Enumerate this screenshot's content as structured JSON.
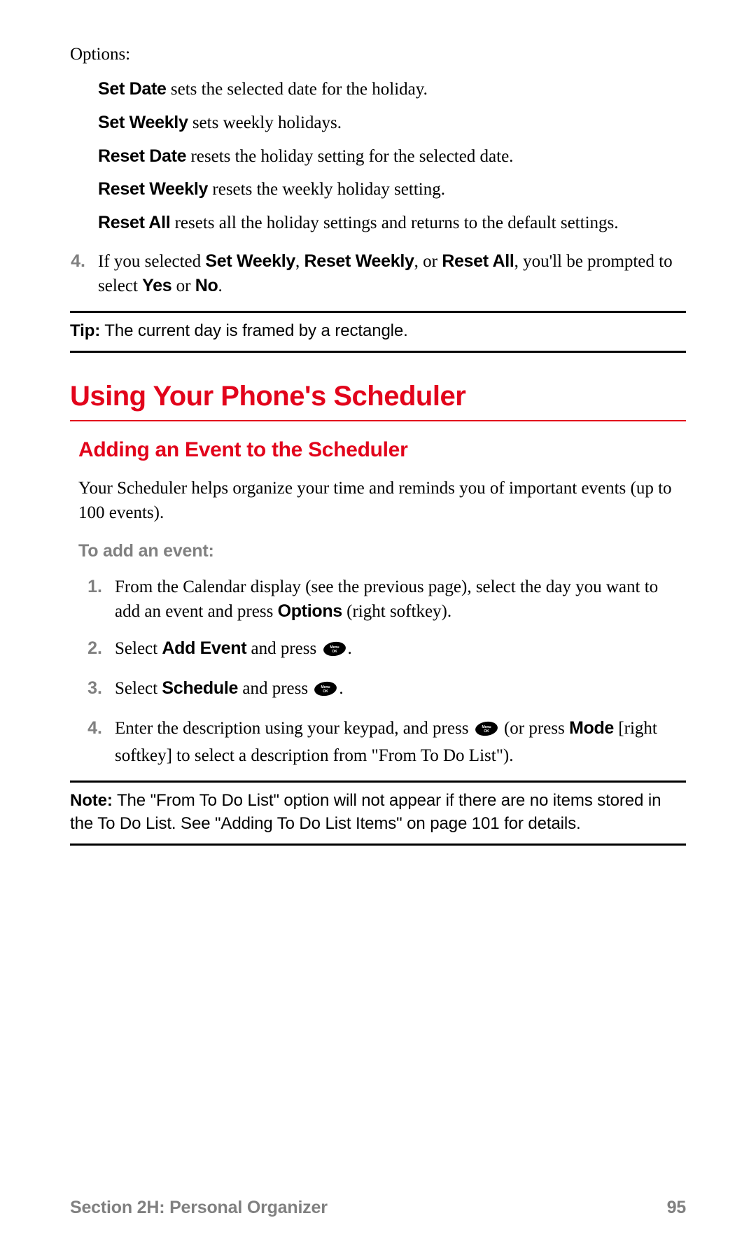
{
  "options_label": "Options:",
  "options": [
    {
      "name": "Set Date",
      "desc": " sets the selected date for the holiday."
    },
    {
      "name": "Set Weekly",
      "desc": " sets weekly holidays."
    },
    {
      "name": "Reset Date",
      "desc": " resets the holiday setting for the selected date."
    },
    {
      "name": "Reset Weekly",
      "desc": " resets the weekly holiday setting."
    },
    {
      "name": "Reset All",
      "desc": " resets all the holiday settings and returns to the default settings."
    }
  ],
  "step4": {
    "num": "4.",
    "pre": "If you selected ",
    "b1": "Set Weekly",
    "mid1": ", ",
    "b2": "Reset Weekly",
    "mid2": ", or ",
    "b3": "Reset All",
    "mid3": ", you'll be prompted to select ",
    "b4": "Yes",
    "mid4": " or ",
    "b5": "No",
    "end": "."
  },
  "tip": {
    "label": "Tip:",
    "text": " The current day is framed by a rectangle."
  },
  "h1": "Using Your Phone's Scheduler",
  "h2": "Adding an Event to the Scheduler",
  "intro": "Your Scheduler helps organize your time and reminds you of important events (up to 100 events).",
  "to_add": "To add an event:",
  "steps": {
    "s1": {
      "num": "1.",
      "pre": "From the Calendar display (see the previous page), select the day you want to add an event and press ",
      "b1": "Options",
      "post": " (right softkey)."
    },
    "s2": {
      "num": "2.",
      "pre": "Select ",
      "b1": "Add Event",
      "mid": " and press ",
      "end": "."
    },
    "s3": {
      "num": "3.",
      "pre": "Select ",
      "b1": "Schedule",
      "mid": " and press ",
      "end": "."
    },
    "s4": {
      "num": "4.",
      "pre": "Enter the description using your keypad, and press ",
      "mid": " (or press ",
      "b1": "Mode",
      "post": " [right softkey] to select a description from \"From To Do List\")."
    }
  },
  "note": {
    "label": "Note:",
    "text": " The \"From To Do List\" option will not appear if there are no items stored in the To Do List. See \"Adding To Do List Items\" on page 101 for details."
  },
  "footer": {
    "section": "Section 2H:  Personal Organizer",
    "page": "95"
  },
  "icon_label": "Menu OK"
}
